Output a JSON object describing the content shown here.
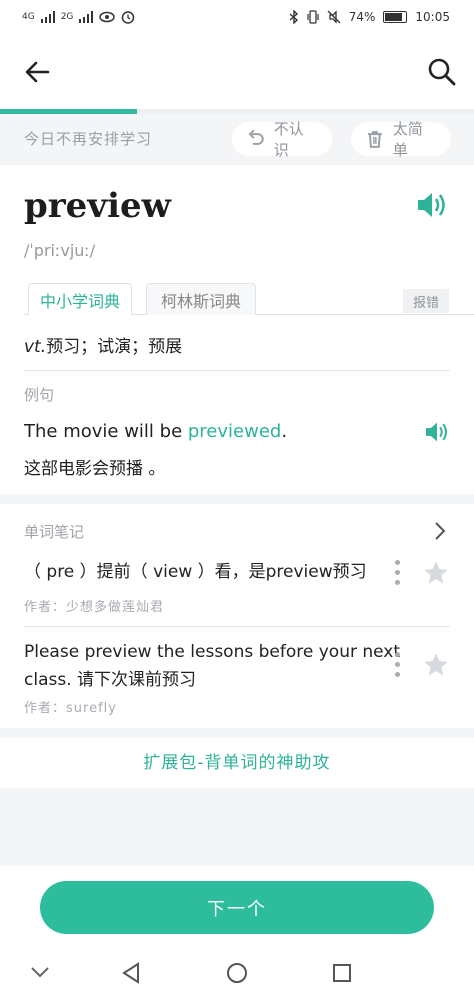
{
  "status_bar": {
    "signal1": "4G",
    "signal2": "2G",
    "battery": "74%",
    "time": "10:05"
  },
  "nav": {
    "back_icon": "arrow-left-icon",
    "search_icon": "search-icon"
  },
  "progress": 0.29,
  "actions": {
    "skip_text": "今日不再安排学习",
    "unknown_label": "不认识",
    "too_easy_label": "太简单"
  },
  "word": {
    "headword": "preview",
    "phonetic": "/ˈpriːvjuː/"
  },
  "dict_tabs": [
    {
      "label": "中小学词典",
      "active": true
    },
    {
      "label": "柯林斯词典",
      "active": false
    }
  ],
  "report_label": "报错",
  "definition": {
    "pos": "vt.",
    "meaning": "预习；试演；预展"
  },
  "example": {
    "section_label": "例句",
    "en_before": "The movie will be ",
    "en_highlight": "previewed",
    "en_after": ".",
    "zh": "这部电影会预播 。"
  },
  "notes": {
    "section_label": "单词笔记",
    "items": [
      {
        "text": "（ pre ）提前（ view ）看，是preview预习",
        "author": "作者：少想多做莲灿君"
      },
      {
        "text_line1": "Please preview the lessons before your next",
        "text_line2": "class. 请下次课前预习",
        "author": "作者：surefly"
      }
    ]
  },
  "expansion_link": "扩展包-背单词的神助攻",
  "next_button": "下一个",
  "colors": {
    "accent": "#2dbd9c",
    "highlight": "#2fb398"
  }
}
